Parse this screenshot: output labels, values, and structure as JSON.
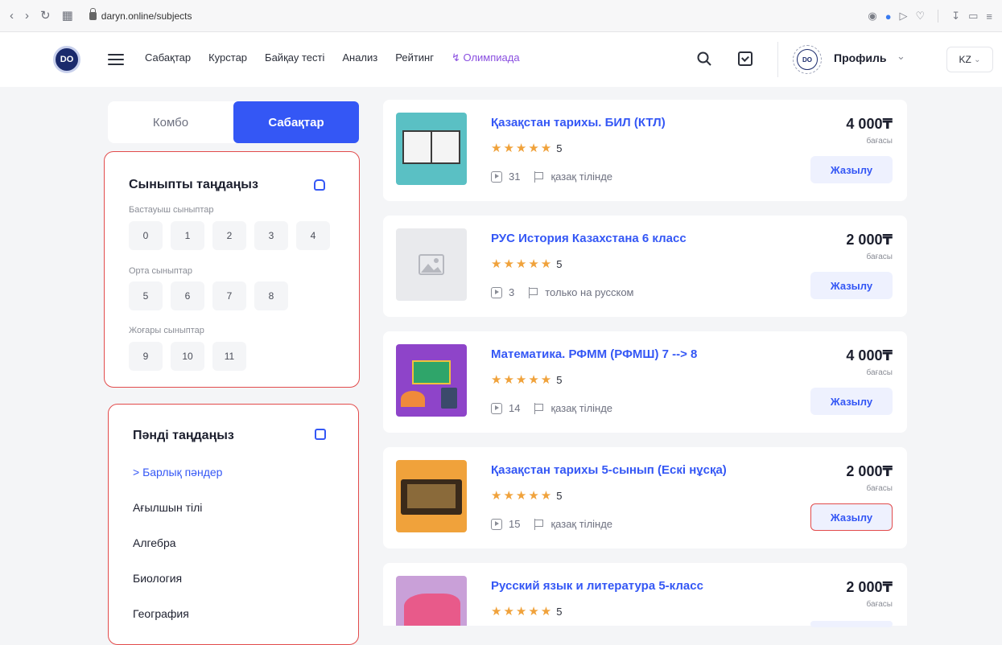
{
  "browser": {
    "url": "daryn.online/subjects"
  },
  "nav": {
    "logo": "DO",
    "items": [
      "Сабақтар",
      "Курстар",
      "Байқау тесті",
      "Анализ",
      "Рейтинг"
    ],
    "olympiad": "Олимпиада",
    "avatar": "DO",
    "profile": "Профиль",
    "lang": "KZ"
  },
  "tabs": [
    "Комбо",
    "Сабақтар"
  ],
  "grades": {
    "title": "Сыныпты таңдаңыз",
    "groups": [
      {
        "label": "Бастауыш сыныптар",
        "items": [
          "0",
          "1",
          "2",
          "3",
          "4"
        ]
      },
      {
        "label": "Орта сыныптар",
        "items": [
          "5",
          "6",
          "7",
          "8"
        ]
      },
      {
        "label": "Жоғары сыныптар",
        "items": [
          "9",
          "10",
          "11"
        ]
      }
    ]
  },
  "subjects": {
    "title": "Пәнді таңдаңыз",
    "items": [
      "> Барлық пәндер",
      "Ағылшын тілі",
      "Алгебра",
      "Биология",
      "География"
    ]
  },
  "price_label": "бағасы",
  "enroll_label": "Жазылу",
  "courses": [
    {
      "title": "Қазақстан тарихы. БИЛ (КТЛ)",
      "rating": "5",
      "lessons": "31",
      "language": "қазақ тілінде",
      "price": "4 000₸"
    },
    {
      "title": "РУС История Казахстана 6 класс",
      "rating": "5",
      "lessons": "3",
      "language": "только на русском",
      "price": "2 000₸"
    },
    {
      "title": "Математика. РФММ (РФМШ) 7 --> 8",
      "rating": "5",
      "lessons": "14",
      "language": "қазақ тілінде",
      "price": "4 000₸"
    },
    {
      "title": "Қазақстан тарихы 5-сынып (Ескі нұсқа)",
      "rating": "5",
      "lessons": "15",
      "language": "қазақ тілінде",
      "price": "2 000₸"
    },
    {
      "title": "Русский язык и литература 5-класс",
      "rating": "5",
      "price": "2 000₸"
    }
  ]
}
